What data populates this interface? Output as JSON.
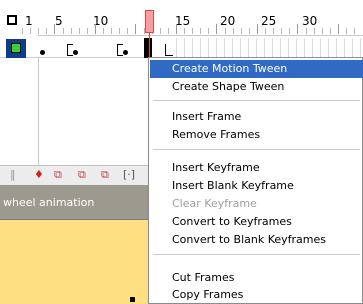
{
  "timeline": {
    "ruler_numbers": [
      "1",
      "5",
      "10",
      "15",
      "20",
      "25",
      "30"
    ],
    "layer_color": "#0b3f8a",
    "layer_swatch_color": "#37d437",
    "playhead_color": "#e04545"
  },
  "toolbar": {
    "icons": [
      "‖",
      "♦",
      "⧉",
      "⧉",
      "⧉",
      "[·]"
    ]
  },
  "scene": {
    "title": "wheel animation",
    "stage_color": "#fedf82"
  },
  "context_menu": {
    "groups": [
      [
        {
          "label": "Create Motion Tween",
          "state": "active"
        },
        {
          "label": "Create Shape Tween",
          "state": "normal"
        }
      ],
      [
        {
          "label": "Insert Frame",
          "state": "normal"
        },
        {
          "label": "Remove Frames",
          "state": "normal"
        }
      ],
      [
        {
          "label": "Insert Keyframe",
          "state": "normal"
        },
        {
          "label": "Insert Blank Keyframe",
          "state": "normal"
        },
        {
          "label": "Clear Keyframe",
          "state": "disabled"
        },
        {
          "label": "Convert to Keyframes",
          "state": "normal"
        },
        {
          "label": "Convert to Blank Keyframes",
          "state": "normal"
        }
      ],
      [
        {
          "label": "Cut Frames",
          "state": "normal"
        },
        {
          "label": "Copy Frames",
          "state": "normal"
        }
      ]
    ]
  }
}
